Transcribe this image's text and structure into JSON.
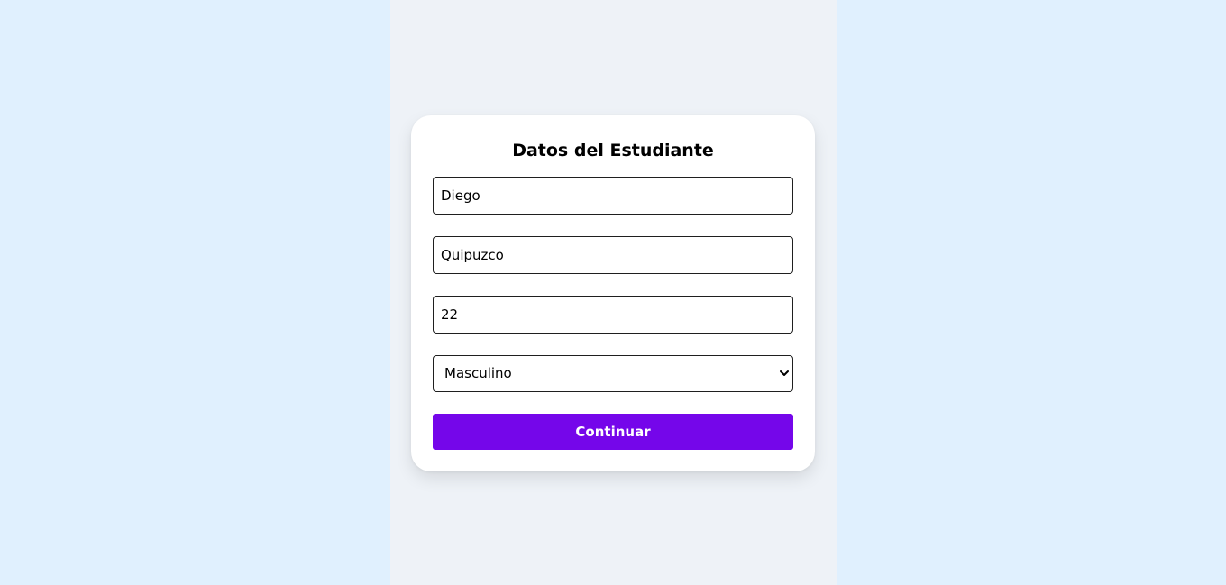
{
  "form": {
    "title": "Datos del Estudiante",
    "first_name": "Diego",
    "last_name": "Quipuzco",
    "age": "22",
    "gender": {
      "selected": "Masculino"
    },
    "continue_label": "Continuar"
  },
  "colors": {
    "background": "#e0f0fe",
    "center_column": "#eef2f7",
    "card": "#ffffff",
    "accent": "#7506ea"
  },
  "icons": {
    "select_arrow": "chevron-down-icon"
  }
}
